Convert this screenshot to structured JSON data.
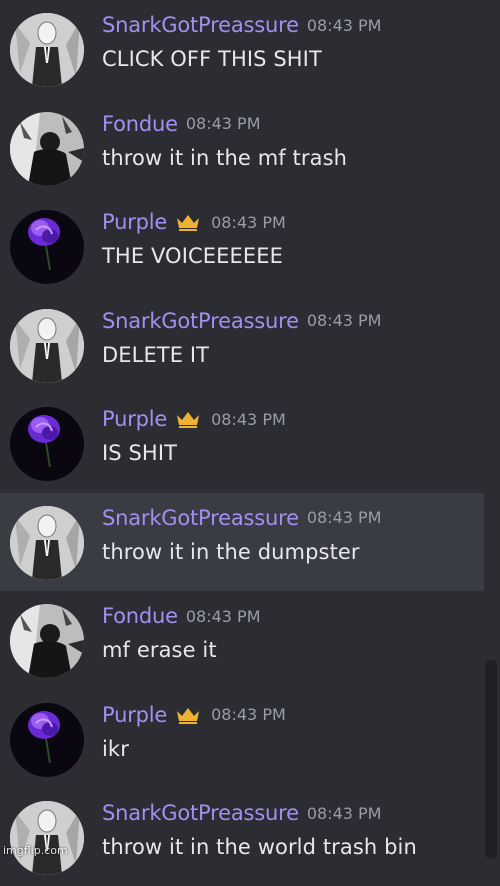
{
  "messages": [
    {
      "user": "SnarkGotPreassure",
      "time": "08:43 PM",
      "text": "CLICK OFF THIS SHIT",
      "avatar": "slender-avatar",
      "crown": false,
      "highlight": false
    },
    {
      "user": "Fondue",
      "time": "08:43 PM",
      "text": "throw it in the mf trash",
      "avatar": "dark-figure-avatar",
      "crown": false,
      "highlight": false
    },
    {
      "user": "Purple",
      "time": "08:43 PM",
      "text": "THE VOICEEEEEE",
      "avatar": "purple-rose-avatar",
      "crown": true,
      "highlight": false
    },
    {
      "user": "SnarkGotPreassure",
      "time": "08:43 PM",
      "text": "DELETE IT",
      "avatar": "slender-avatar",
      "crown": false,
      "highlight": false
    },
    {
      "user": "Purple",
      "time": "08:43 PM",
      "text": "IS SHIT",
      "avatar": "purple-rose-avatar",
      "crown": true,
      "highlight": false
    },
    {
      "user": "SnarkGotPreassure",
      "time": "08:43 PM",
      "text": "throw it in the dumpster",
      "avatar": "slender-avatar",
      "crown": false,
      "highlight": true
    },
    {
      "user": "Fondue",
      "time": "08:43 PM",
      "text": "mf erase it",
      "avatar": "dark-figure-avatar",
      "crown": false,
      "highlight": false
    },
    {
      "user": "Purple",
      "time": "08:43 PM",
      "text": "ikr",
      "avatar": "purple-rose-avatar",
      "crown": true,
      "highlight": false
    },
    {
      "user": "SnarkGotPreassure",
      "time": "08:43 PM",
      "text": "throw it in the world trash bin",
      "avatar": "slender-avatar",
      "crown": false,
      "highlight": false
    }
  ],
  "colors": {
    "username": "#a58ef2",
    "timestamp": "#9a9ca6",
    "text": "#e8e8ec",
    "background": "#2b2d33",
    "crown": "#f0b232"
  },
  "watermark": "imgflip.com"
}
